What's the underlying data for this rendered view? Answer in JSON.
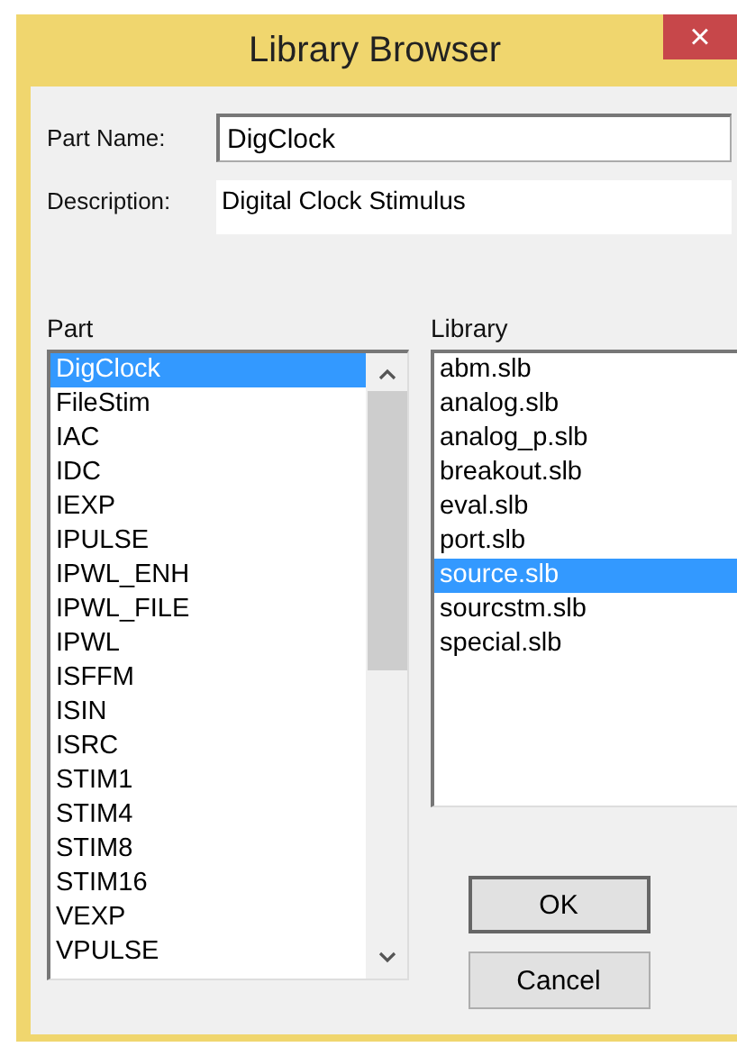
{
  "window": {
    "title": "Library Browser",
    "close": "×"
  },
  "part_name": {
    "label": "Part Name:",
    "value": "DigClock"
  },
  "description": {
    "label": "Description:",
    "value": "Digital Clock Stimulus"
  },
  "part_list": {
    "label": "Part",
    "items": [
      {
        "label": "DigClock",
        "selected": true
      },
      {
        "label": "FileStim",
        "selected": false
      },
      {
        "label": "IAC",
        "selected": false
      },
      {
        "label": "IDC",
        "selected": false
      },
      {
        "label": "IEXP",
        "selected": false
      },
      {
        "label": "IPULSE",
        "selected": false
      },
      {
        "label": "IPWL_ENH",
        "selected": false
      },
      {
        "label": "IPWL_FILE",
        "selected": false
      },
      {
        "label": "IPWL",
        "selected": false
      },
      {
        "label": "ISFFM",
        "selected": false
      },
      {
        "label": "ISIN",
        "selected": false
      },
      {
        "label": "ISRC",
        "selected": false
      },
      {
        "label": "STIM1",
        "selected": false
      },
      {
        "label": "STIM4",
        "selected": false
      },
      {
        "label": "STIM8",
        "selected": false
      },
      {
        "label": "STIM16",
        "selected": false
      },
      {
        "label": "VEXP",
        "selected": false
      },
      {
        "label": "VPULSE",
        "selected": false
      }
    ]
  },
  "library_list": {
    "label": "Library",
    "items": [
      {
        "label": "abm.slb",
        "selected": false
      },
      {
        "label": "analog.slb",
        "selected": false
      },
      {
        "label": "analog_p.slb",
        "selected": false
      },
      {
        "label": "breakout.slb",
        "selected": false
      },
      {
        "label": "eval.slb",
        "selected": false
      },
      {
        "label": "port.slb",
        "selected": false
      },
      {
        "label": "source.slb",
        "selected": true
      },
      {
        "label": "sourcstm.slb",
        "selected": false
      },
      {
        "label": "special.slb",
        "selected": false
      }
    ]
  },
  "buttons": [
    {
      "label": "OK",
      "default": true
    },
    {
      "label": "Cancel",
      "default": false
    }
  ]
}
